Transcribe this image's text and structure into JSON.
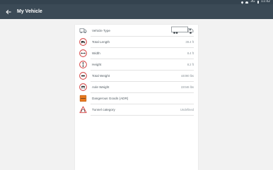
{
  "status_bar": {
    "network": "3G",
    "time": "11:42"
  },
  "app_bar": {
    "title": "My Vehicle",
    "back_icon": "arrow-left-icon"
  },
  "vehicle_rows": [
    {
      "label": "Vehicle Type",
      "value": "",
      "icon": "truck-type-icon"
    },
    {
      "label": "Total Length",
      "value": "39.4 ft",
      "icon": "length-sign-icon"
    },
    {
      "label": "Width",
      "value": "8.4 ft",
      "icon": "width-sign-icon"
    },
    {
      "label": "Height",
      "value": "8.2 ft",
      "icon": "height-sign-icon"
    },
    {
      "label": "Total Weight",
      "value": "44090 lbs",
      "icon": "weight-sign-icon"
    },
    {
      "label": "Axle Weight",
      "value": "22046 lbs",
      "icon": "axle-weight-sign-icon"
    },
    {
      "label": "Dangerous Goods (ADR)",
      "value": "",
      "icon": "dangerous-goods-icon"
    },
    {
      "label": "Tunnel category",
      "value": "Undefined",
      "icon": "tunnel-warning-icon"
    }
  ],
  "colors": {
    "status_bar": "#34434f",
    "app_bar": "#3b4a56",
    "sign_border": "#d33b3b",
    "adr_orange": "#e8791f"
  }
}
